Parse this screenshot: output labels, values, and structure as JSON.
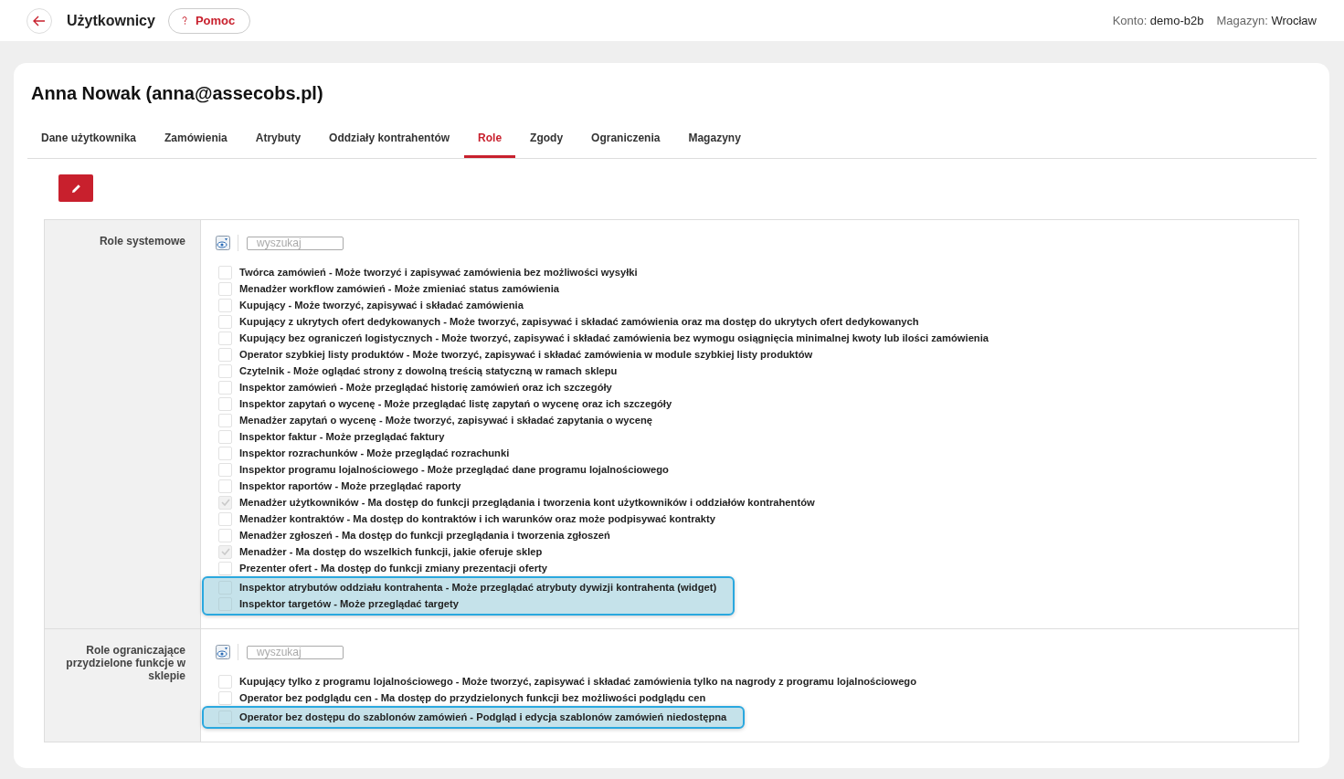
{
  "header": {
    "title": "Użytkownicy",
    "help_button": "Pomoc",
    "account_label": "Konto:",
    "account": "demo-b2b",
    "warehouse_label": "Magazyn:",
    "warehouse": "Wrocław"
  },
  "user_title": "Anna Nowak (anna@assecobs.pl)",
  "tabs": [
    {
      "label": "Dane użytkownika",
      "selected": false
    },
    {
      "label": "Zamówienia",
      "selected": false
    },
    {
      "label": "Atrybuty",
      "selected": false
    },
    {
      "label": "Oddziały kontrahentów",
      "selected": false
    },
    {
      "label": "Role",
      "selected": true
    },
    {
      "label": "Zgody",
      "selected": false
    },
    {
      "label": "Ograniczenia",
      "selected": false
    },
    {
      "label": "Magazyny",
      "selected": false
    }
  ],
  "sections": [
    {
      "label": "Role systemowe",
      "search_placeholder": "wyszukaj",
      "roles": [
        {
          "label": "Twórca zamówień - Może tworzyć i zapisywać zamówienia bez możliwości wysyłki",
          "checked": false,
          "highlighted": false
        },
        {
          "label": "Menadżer workflow zamówień - Może zmieniać status zamówienia",
          "checked": false,
          "highlighted": false
        },
        {
          "label": "Kupujący - Może tworzyć, zapisywać i składać zamówienia",
          "checked": false,
          "highlighted": false
        },
        {
          "label": "Kupujący z ukrytych ofert dedykowanych - Może tworzyć, zapisywać i składać zamówienia oraz ma dostęp do ukrytych ofert dedykowanych",
          "checked": false,
          "highlighted": false
        },
        {
          "label": "Kupujący bez ograniczeń logistycznych - Może tworzyć, zapisywać i składać zamówienia bez wymogu osiągnięcia minimalnej kwoty lub ilości zamówienia",
          "checked": false,
          "highlighted": false
        },
        {
          "label": "Operator szybkiej listy produktów - Może tworzyć, zapisywać i składać zamówienia w module szybkiej listy produktów",
          "checked": false,
          "highlighted": false
        },
        {
          "label": "Czytelnik - Może oglądać strony z dowolną treścią statyczną w ramach sklepu",
          "checked": false,
          "highlighted": false
        },
        {
          "label": "Inspektor zamówień - Może przeglądać historię zamówień oraz ich szczegóły",
          "checked": false,
          "highlighted": false
        },
        {
          "label": "Inspektor zapytań o wycenę - Może przeglądać listę zapytań o wycenę oraz ich szczegóły",
          "checked": false,
          "highlighted": false
        },
        {
          "label": "Menadżer zapytań o wycenę - Może tworzyć, zapisywać i składać zapytania o wycenę",
          "checked": false,
          "highlighted": false
        },
        {
          "label": "Inspektor faktur - Może przeglądać faktury",
          "checked": false,
          "highlighted": false
        },
        {
          "label": "Inspektor rozrachunków - Może przeglądać rozrachunki",
          "checked": false,
          "highlighted": false
        },
        {
          "label": "Inspektor programu lojalnościowego - Może przeglądać dane programu lojalnościowego",
          "checked": false,
          "highlighted": false
        },
        {
          "label": "Inspektor raportów - Może przeglądać raporty",
          "checked": false,
          "highlighted": false
        },
        {
          "label": "Menadżer użytkowników - Ma dostęp do funkcji przeglądania i tworzenia kont użytkowników i oddziałów kontrahentów",
          "checked": true,
          "highlighted": false
        },
        {
          "label": "Menadżer kontraktów - Ma dostęp do kontraktów i ich warunków oraz może podpisywać kontrakty",
          "checked": false,
          "highlighted": false
        },
        {
          "label": "Menadżer zgłoszeń - Ma dostęp do funkcji przeglądania i tworzenia zgłoszeń",
          "checked": false,
          "highlighted": false
        },
        {
          "label": "Menadżer - Ma dostęp do wszelkich funkcji, jakie oferuje sklep",
          "checked": true,
          "highlighted": false
        },
        {
          "label": "Prezenter ofert - Ma dostęp do funkcji zmiany prezentacji oferty",
          "checked": false,
          "highlighted": false
        },
        {
          "label": "Inspektor atrybutów oddziału kontrahenta - Może przeglądać atrybuty dywizji kontrahenta (widget)",
          "checked": false,
          "highlighted": true
        },
        {
          "label": "Inspektor targetów - Może przeglądać targety",
          "checked": false,
          "highlighted": true
        }
      ]
    },
    {
      "label": "Role ograniczające przydzielone funkcje w sklepie",
      "search_placeholder": "wyszukaj",
      "roles": [
        {
          "label": "Kupujący tylko z programu lojalnościowego - Może tworzyć, zapisywać i składać zamówienia tylko na nagrody z programu lojalnościowego",
          "checked": false,
          "highlighted": false
        },
        {
          "label": "Operator bez podglądu cen - Ma dostęp do przydzielonych funkcji bez możliwości podglądu cen",
          "checked": false,
          "highlighted": false
        },
        {
          "label": "Operator bez dostępu do szablonów zamówień - Podgląd i edycja szablonów zamówień niedostępna",
          "checked": false,
          "highlighted": true
        }
      ]
    }
  ]
}
